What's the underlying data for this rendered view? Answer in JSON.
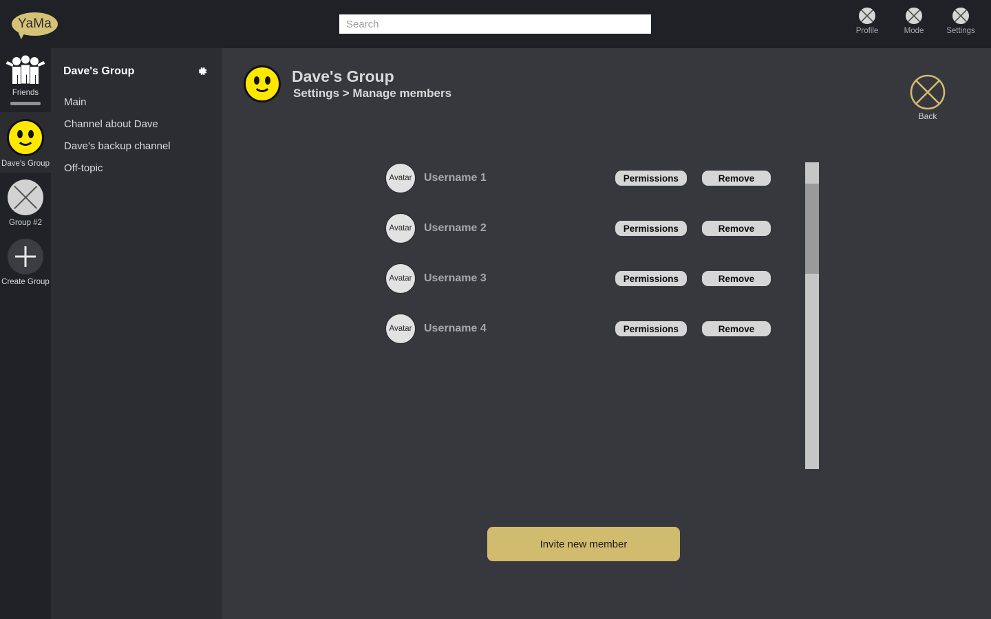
{
  "app": {
    "logo_text": "YaMa"
  },
  "topbar": {
    "search": {
      "placeholder": "Search",
      "value": ""
    },
    "actions": [
      {
        "label": "Profile",
        "icon": "x-circle-icon"
      },
      {
        "label": "Mode",
        "icon": "x-circle-icon"
      },
      {
        "label": "Settings",
        "icon": "x-circle-icon"
      }
    ]
  },
  "rail": {
    "items": [
      {
        "label": "Friends",
        "icon": "friends-group-icon",
        "selected": false
      },
      {
        "label": "Dave's Group",
        "icon": "smiley-face-icon",
        "selected": true
      },
      {
        "label": "Group #2",
        "icon": "x-circle-icon",
        "selected": false
      },
      {
        "label": "Create Group",
        "icon": "plus-icon",
        "selected": false
      }
    ]
  },
  "channels": {
    "title": "Dave's Group",
    "settings_icon": "gear-icon",
    "items": [
      {
        "label": "Main"
      },
      {
        "label": "Channel about Dave"
      },
      {
        "label": "Dave's backup channel"
      },
      {
        "label": "Off-topic"
      }
    ]
  },
  "main": {
    "group_icon": "smiley-face-icon",
    "title": "Dave's Group",
    "breadcrumb": "Settings > Manage members",
    "back": {
      "label": "Back",
      "icon": "x-circle-icon"
    },
    "members": [
      {
        "avatar_label": "Avatar",
        "username": "Username 1",
        "permissions_label": "Permissions",
        "remove_label": "Remove"
      },
      {
        "avatar_label": "Avatar",
        "username": "Username 2",
        "permissions_label": "Permissions",
        "remove_label": "Remove"
      },
      {
        "avatar_label": "Avatar",
        "username": "Username 3",
        "permissions_label": "Permissions",
        "remove_label": "Remove"
      },
      {
        "avatar_label": "Avatar",
        "username": "Username 4",
        "permissions_label": "Permissions",
        "remove_label": "Remove"
      }
    ],
    "invite_label": "Invite new member"
  },
  "colors": {
    "brand_gold": "#d0bb6e",
    "logo_gold": "#d6c277",
    "smiley_yellow": "#ffe800",
    "rail_bg": "#202227",
    "channels_bg": "#2b2d31",
    "main_bg": "#36383d",
    "topbar_bg": "#1f2126",
    "button_gray": "#d6d6d6"
  }
}
